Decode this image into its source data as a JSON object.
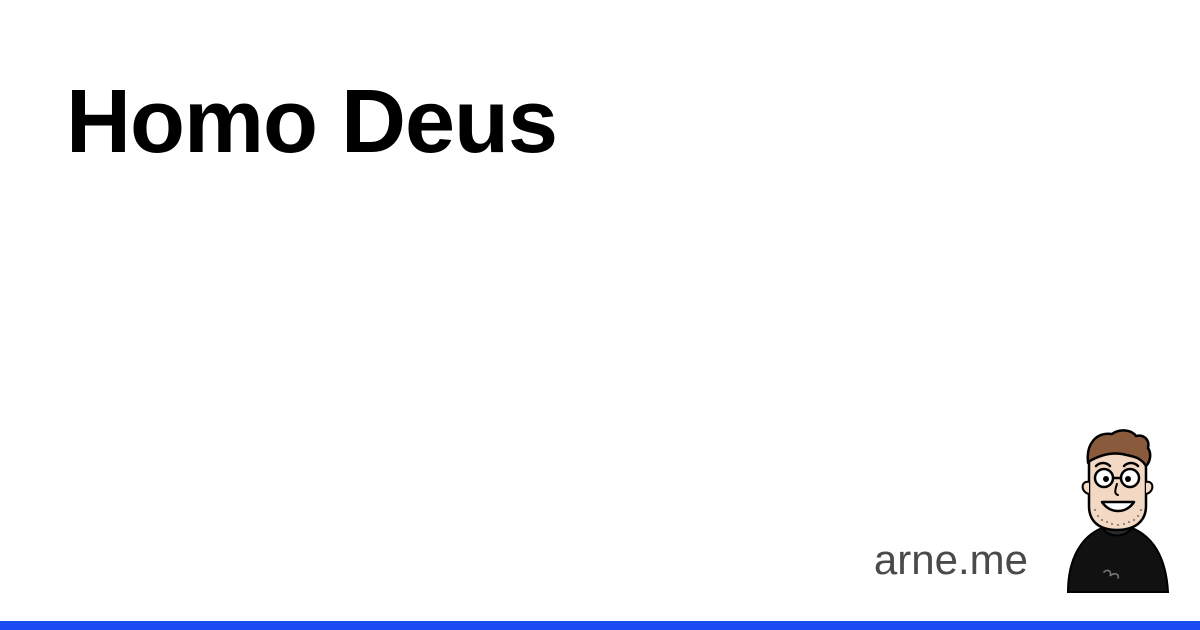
{
  "card": {
    "title": "Homo Deus",
    "site": "arne.me"
  },
  "avatar": {
    "icon": "cartoon-avatar-icon"
  },
  "colors": {
    "background": "#ffffff",
    "title": "#000000",
    "site": "#4a4a4a",
    "accent_bar": "#1a4cf2",
    "shirt": "#111111",
    "hair": "#8a5a3c",
    "skin": "#f3d9c4"
  }
}
